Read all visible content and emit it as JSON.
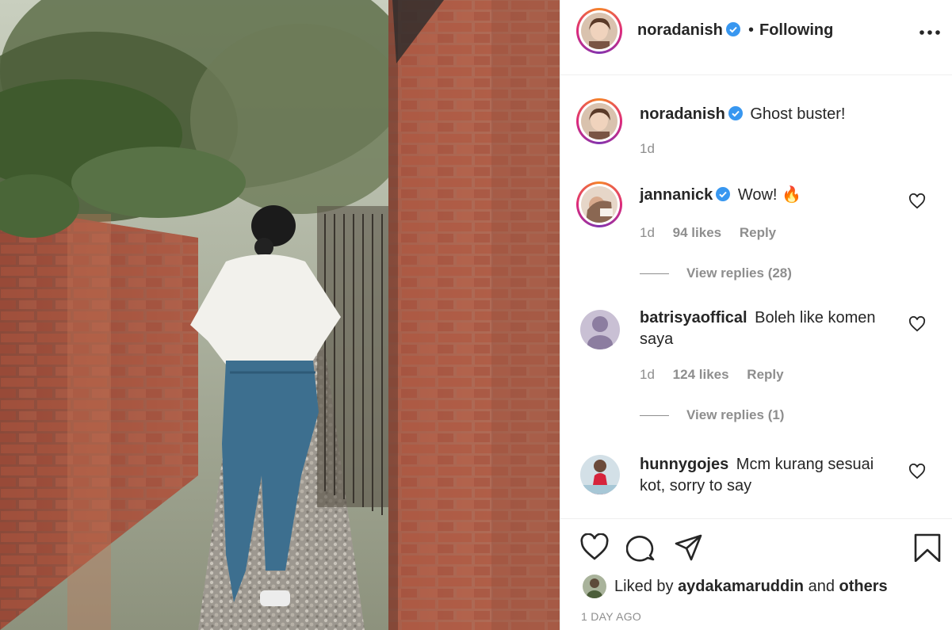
{
  "post": {
    "author": "noradanish",
    "follow_sep": "•",
    "follow_status": "Following",
    "more_icon": "more-horizontal-icon",
    "verified_color": "#3897f0"
  },
  "comments": [
    {
      "username": "noradanish",
      "text": "Ghost buster!",
      "time": "1d",
      "likes": "",
      "reply": "",
      "view_replies": "",
      "is_caption": true
    },
    {
      "username": "jannanick",
      "text": "Wow! 🔥",
      "time": "1d",
      "likes": "94 likes",
      "reply": "Reply",
      "view_replies": "View replies (28)"
    },
    {
      "username": "batrisyaoffical",
      "text": "Boleh like komen saya",
      "time": "1d",
      "likes": "124 likes",
      "reply": "Reply",
      "view_replies": "View replies (1)"
    },
    {
      "username": "hunnygojes",
      "text": "Mcm kurang sesuai kot, sorry to say",
      "time": "",
      "likes": "",
      "reply": "",
      "view_replies": ""
    }
  ],
  "actions": {
    "icons": [
      "heart-icon",
      "comment-icon",
      "share-icon",
      "bookmark-icon"
    ],
    "liked_by_prefix": "Liked by",
    "liked_by_user": "aydakamaruddin",
    "liked_by_and": "and",
    "liked_by_others": "others",
    "timestamp": "1 DAY AGO"
  }
}
